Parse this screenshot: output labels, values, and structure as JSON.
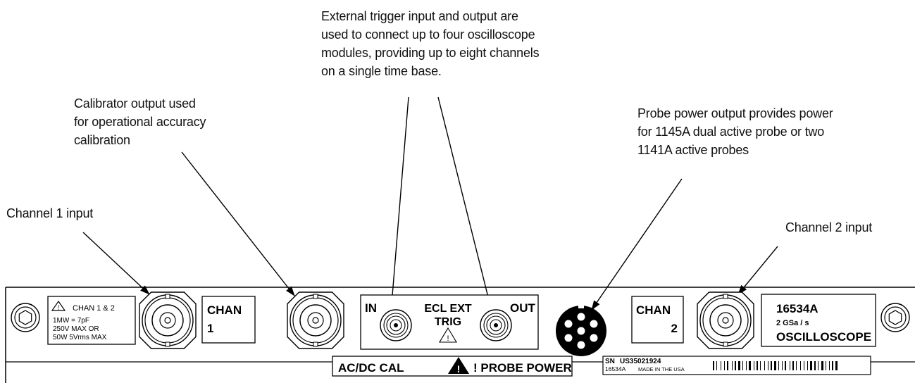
{
  "callouts": {
    "channel1": {
      "lines": [
        "Channel 1 input"
      ]
    },
    "calibrator": {
      "lines": [
        "Calibrator output used",
        "for operational accuracy",
        "calibration"
      ]
    },
    "trigger": {
      "lines": [
        "External trigger input and output are",
        "used to connect up to four oscilloscope",
        "modules, providing up to eight channels",
        "on a single time base."
      ]
    },
    "probe_power": {
      "lines": [
        "Probe power output provides power",
        "for 1145A dual active probe or two",
        "1141A active probes"
      ]
    },
    "channel2": {
      "lines": [
        "Channel 2 input"
      ]
    }
  },
  "panel": {
    "warning_box": {
      "title": "CHAN 1 & 2",
      "line1": "1MW  = 7pF",
      "line2": "250V  MAX  OR",
      "line3": "50W  5Vrms  MAX"
    },
    "chan1_label": {
      "line1": "CHAN",
      "line2": "1"
    },
    "chan2_label": {
      "line1": "CHAN",
      "line2": "2"
    },
    "trigger_box": {
      "in": "IN",
      "ecl_ext": "ECL  EXT",
      "trig": "TRIG",
      "out": "OUT"
    },
    "bottom_label": {
      "acdc": "AC/DC CAL",
      "probe_power": "! PROBE POWER"
    },
    "serial_box": {
      "sn_label": "SN",
      "sn_value": "US35021924",
      "model": "16534A",
      "made_in": "MADE IN THE USA"
    },
    "model_box": {
      "model": "16534A",
      "rate": "2  GSa / s",
      "name": "OSCILLOSCOPE"
    }
  }
}
